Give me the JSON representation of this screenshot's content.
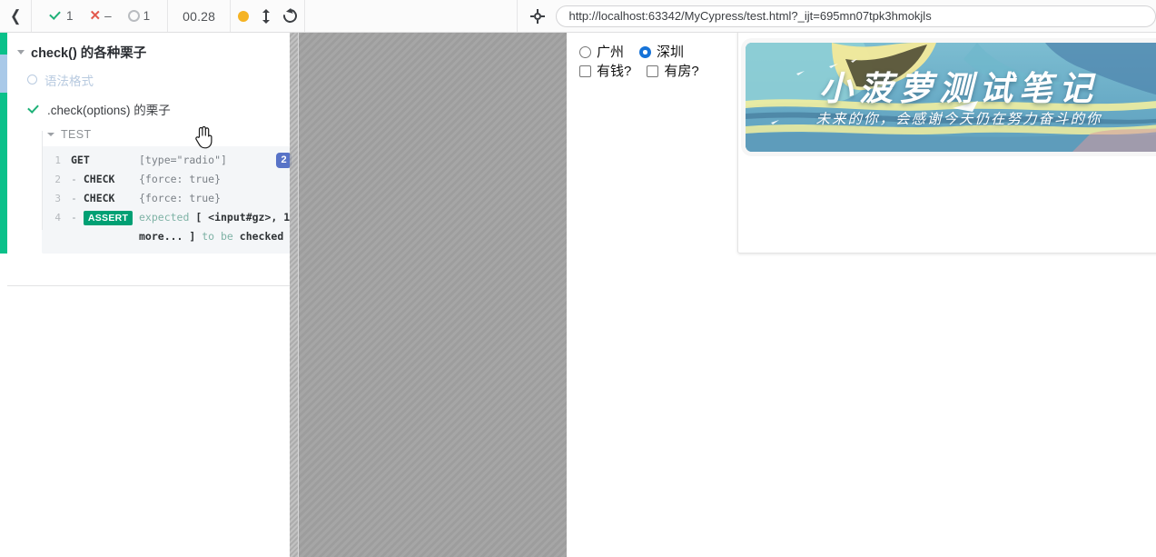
{
  "topbar": {
    "back_icon": "chevron-left-icon",
    "stats": [
      {
        "icon": "check-icon",
        "value": "1"
      },
      {
        "icon": "x-icon",
        "value": "–"
      },
      {
        "icon": "circle-icon",
        "value": "1"
      }
    ],
    "timer": "00.28",
    "controls": [
      {
        "icon": "record-dot-icon",
        "label": ""
      },
      {
        "icon": "up-down-arrow-icon",
        "label": ""
      },
      {
        "icon": "reload-icon",
        "label": ""
      }
    ],
    "selector_playground_icon": "crosshair-selector-icon",
    "url": "http://localhost:63342/MyCypress/test.html?_ijt=695mn07tpk3hmokjls"
  },
  "reporter": {
    "suite_title": "check() 的各种栗子",
    "tests": [
      {
        "label": "语法格式",
        "state": "pending"
      },
      {
        "label": ".check(options) 的栗子",
        "state": "passed"
      }
    ],
    "hook_title": "TEST",
    "commands": [
      {
        "num": "1",
        "name": "GET",
        "prefix": "",
        "message": "[type=\"radio\"]",
        "badge": "2"
      },
      {
        "num": "2",
        "name": "CHECK",
        "prefix": "-",
        "message": "{force: true}",
        "badge": ""
      },
      {
        "num": "3",
        "name": "CHECK",
        "prefix": "-",
        "message": "{force: true}",
        "badge": ""
      },
      {
        "num": "4",
        "name": "ASSERT",
        "prefix": "-",
        "message_parts": {
          "w1": "expected ",
          "w2": "[ <input#gz>, 1 more... ]",
          "w3": " to be ",
          "w4": "checked"
        },
        "badge": ""
      }
    ]
  },
  "app": {
    "radios": [
      {
        "label": "广州",
        "checked": false
      },
      {
        "label": "深圳",
        "checked": true
      }
    ],
    "checkboxes": [
      {
        "label": "有钱?",
        "checked": false
      },
      {
        "label": "有房?",
        "checked": false
      }
    ],
    "banner": {
      "title": "小菠萝测试笔记",
      "subtitle": "未来的你，会感谢今天仍在努力奋斗的你"
    }
  },
  "colors": {
    "pass_green": "#0ac18a",
    "fail_red": "#e35a4e",
    "pending_blue": "#a9c9e8",
    "assert_teal": "#00a074",
    "badge_blue": "#5873c7",
    "accent_orange": "#f5b323"
  }
}
